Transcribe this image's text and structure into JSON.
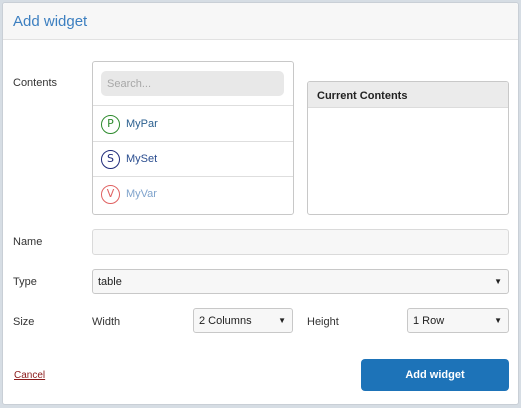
{
  "dialog": {
    "title": "Add widget"
  },
  "contents": {
    "label": "Contents",
    "search_placeholder": "Search...",
    "items": [
      {
        "badge": "P",
        "label": "MyPar",
        "badge_color": "#2e8b2e",
        "label_color": "#2a5f8f"
      },
      {
        "badge": "S",
        "label": "MySet",
        "badge_color": "#1f2a7a",
        "label_color": "#2a4d8f"
      },
      {
        "badge": "V",
        "label": "MyVar",
        "badge_color": "#e06262",
        "label_color": "#7fa3cc"
      }
    ]
  },
  "current_contents": {
    "title": "Current Contents"
  },
  "name": {
    "label": "Name",
    "value": ""
  },
  "type": {
    "label": "Type",
    "value": "table"
  },
  "size": {
    "label": "Size",
    "width_label": "Width",
    "width_value": "2 Columns",
    "height_label": "Height",
    "height_value": "1 Row"
  },
  "footer": {
    "cancel_label": "Cancel",
    "add_label": "Add widget"
  },
  "icons": {
    "dropdown": "caret-down-icon"
  },
  "colors": {
    "accent": "#1d73b8",
    "title": "#3c7fc0",
    "cancel": "#8b1a1a"
  }
}
